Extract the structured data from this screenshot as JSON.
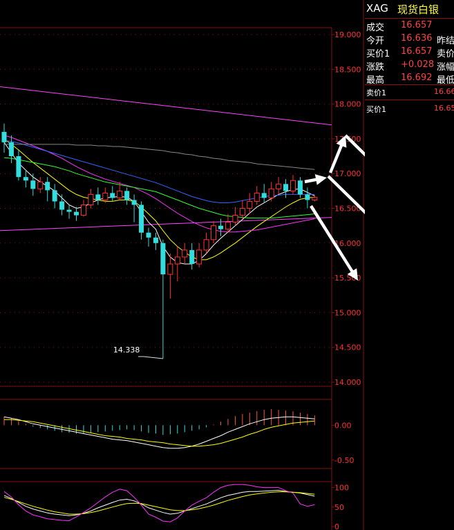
{
  "quote": {
    "code": "XAG",
    "name": "现货白银",
    "rows": [
      {
        "label": "成交",
        "value": "16.657",
        "label2": ""
      },
      {
        "label": "今开",
        "value": "16.636",
        "label2": "昨结"
      },
      {
        "label": "买价1",
        "value": "16.657",
        "label2": "卖价"
      },
      {
        "label": "涨跌",
        "value": "+0.028",
        "label2": "涨幅"
      },
      {
        "label": "最高",
        "value": "16.692",
        "label2": "最低"
      }
    ],
    "ask_label": "卖价1",
    "ask_value": "16.66",
    "bid_label": "买价1",
    "bid_value": "16.65"
  },
  "chart_data": [
    {
      "type": "candlestick",
      "panel": "price",
      "y_ticks": [
        "19.000",
        "18.500",
        "18.000",
        "17.500",
        "17.000",
        "16.500",
        "16.000",
        "15.500",
        "15.000",
        "14.500",
        "14.000"
      ],
      "ylim": [
        14.0,
        19.0
      ],
      "low_annotation": "14.338",
      "low_value": 14.338,
      "candles": [
        [
          17.6,
          17.45,
          17.72,
          17.3
        ],
        [
          17.45,
          17.25,
          17.55,
          17.15
        ],
        [
          17.25,
          16.95,
          17.35,
          16.9
        ],
        [
          16.95,
          16.9,
          17.05,
          16.8
        ],
        [
          16.9,
          16.78,
          17.0,
          16.68
        ],
        [
          16.78,
          16.88,
          16.95,
          16.72
        ],
        [
          16.88,
          16.76,
          16.95,
          16.6
        ],
        [
          16.76,
          16.6,
          16.85,
          16.5
        ],
        [
          16.6,
          16.48,
          16.7,
          16.4
        ],
        [
          16.48,
          16.45,
          16.55,
          16.35
        ],
        [
          16.45,
          16.4,
          16.52,
          16.32
        ],
        [
          16.4,
          16.55,
          16.62,
          16.38
        ],
        [
          16.55,
          16.7,
          16.78,
          16.5
        ],
        [
          16.7,
          16.62,
          16.8,
          16.55
        ],
        [
          16.62,
          16.72,
          16.8,
          16.58
        ],
        [
          16.72,
          16.65,
          16.82,
          16.6
        ],
        [
          16.65,
          16.75,
          16.88,
          16.62
        ],
        [
          16.75,
          16.62,
          16.8,
          16.55
        ],
        [
          16.62,
          16.55,
          16.7,
          16.3
        ],
        [
          16.55,
          16.15,
          16.6,
          16.05
        ],
        [
          16.15,
          16.08,
          16.22,
          15.95
        ],
        [
          16.08,
          16.0,
          16.15,
          15.9
        ],
        [
          16.0,
          15.55,
          16.05,
          14.338
        ],
        [
          15.55,
          15.7,
          15.85,
          15.2
        ],
        [
          15.7,
          15.8,
          15.95,
          15.45
        ],
        [
          15.8,
          15.9,
          16.0,
          15.7
        ],
        [
          15.9,
          15.7,
          16.0,
          15.62
        ],
        [
          15.7,
          15.9,
          16.0,
          15.65
        ],
        [
          15.9,
          16.05,
          16.15,
          15.85
        ],
        [
          16.05,
          16.25,
          16.32,
          16.0
        ],
        [
          16.25,
          16.2,
          16.35,
          16.1
        ],
        [
          16.2,
          16.3,
          16.42,
          16.15
        ],
        [
          16.3,
          16.4,
          16.52,
          16.25
        ],
        [
          16.4,
          16.5,
          16.62,
          16.35
        ],
        [
          16.5,
          16.6,
          16.72,
          16.42
        ],
        [
          16.6,
          16.72,
          16.82,
          16.55
        ],
        [
          16.72,
          16.65,
          16.85,
          16.58
        ],
        [
          16.65,
          16.78,
          16.88,
          16.6
        ],
        [
          16.78,
          16.85,
          16.95,
          16.7
        ],
        [
          16.85,
          16.75,
          16.92,
          16.65
        ],
        [
          16.75,
          16.9,
          16.98,
          16.7
        ],
        [
          16.9,
          16.7,
          16.95,
          16.65
        ],
        [
          16.7,
          16.62,
          16.8,
          16.5
        ],
        [
          16.62,
          16.657,
          16.692,
          16.6
        ]
      ],
      "ma_series": [
        {
          "color": "#ffffff",
          "values": [
            17.45,
            17.3,
            17.15,
            17.05,
            16.95,
            16.88,
            16.82,
            16.75,
            16.65,
            16.55,
            16.5,
            16.52,
            16.58,
            16.62,
            16.65,
            16.66,
            16.67,
            16.66,
            16.6,
            16.45,
            16.3,
            16.2,
            15.95,
            15.8,
            15.72,
            15.7,
            15.7,
            15.75,
            15.85,
            15.97,
            16.07,
            16.16,
            16.25,
            16.34,
            16.43,
            16.52,
            16.58,
            16.64,
            16.7,
            16.74,
            16.77,
            16.78,
            16.73,
            16.68
          ]
        },
        {
          "color": "#ffff00",
          "values": [
            17.5,
            17.42,
            17.34,
            17.25,
            17.16,
            17.08,
            17.0,
            16.92,
            16.84,
            16.76,
            16.7,
            16.66,
            16.64,
            16.62,
            16.6,
            16.6,
            16.62,
            16.62,
            16.6,
            16.52,
            16.42,
            16.32,
            16.18,
            16.05,
            15.95,
            15.87,
            15.8,
            15.76,
            15.76,
            15.8,
            15.86,
            15.93,
            16.0,
            16.08,
            16.16,
            16.24,
            16.31,
            16.38,
            16.45,
            16.52,
            16.58,
            16.63,
            16.65,
            16.66
          ]
        },
        {
          "color": "#ff33ff",
          "values": [
            17.55,
            17.52,
            17.48,
            17.44,
            17.4,
            17.36,
            17.32,
            17.27,
            17.22,
            17.16,
            17.1,
            17.05,
            17.0,
            16.96,
            16.92,
            16.89,
            16.86,
            16.83,
            16.8,
            16.75,
            16.7,
            16.64,
            16.57,
            16.5,
            16.43,
            16.37,
            16.31,
            16.26,
            16.22,
            16.19,
            16.17,
            16.16,
            16.16,
            16.17,
            16.18,
            16.19,
            16.21,
            16.23,
            16.25,
            16.27,
            16.29,
            16.31,
            16.33,
            16.35
          ]
        },
        {
          "color": "#33ff33",
          "values": [
            17.23,
            17.22,
            17.2,
            17.18,
            17.16,
            17.14,
            17.12,
            17.1,
            17.07,
            17.04,
            17.0,
            16.97,
            16.94,
            16.91,
            16.88,
            16.86,
            16.84,
            16.82,
            16.8,
            16.78,
            16.76,
            16.74,
            16.7,
            16.66,
            16.62,
            16.58,
            16.54,
            16.5,
            16.47,
            16.44,
            16.41,
            16.39,
            16.38,
            16.37,
            16.36,
            16.36,
            16.36,
            16.36,
            16.37,
            16.38,
            16.39,
            16.4,
            16.41,
            16.42
          ]
        },
        {
          "color": "#3366ff",
          "values": [
            17.48,
            17.46,
            17.44,
            17.41,
            17.38,
            17.35,
            17.32,
            17.29,
            17.26,
            17.23,
            17.2,
            17.17,
            17.14,
            17.11,
            17.08,
            17.05,
            17.02,
            16.99,
            16.96,
            16.93,
            16.9,
            16.87,
            16.83,
            16.79,
            16.75,
            16.71,
            16.67,
            16.64,
            16.61,
            16.59,
            16.58,
            16.58,
            16.59,
            16.61,
            16.63,
            16.65,
            16.67,
            16.68,
            16.69,
            16.7,
            16.7,
            16.7,
            16.7,
            16.7
          ]
        },
        {
          "color": "#888888",
          "values": [
            17.42,
            17.42,
            17.42,
            17.42,
            17.42,
            17.42,
            17.42,
            17.42,
            17.42,
            17.42,
            17.41,
            17.41,
            17.41,
            17.4,
            17.4,
            17.39,
            17.39,
            17.38,
            17.37,
            17.36,
            17.35,
            17.34,
            17.33,
            17.31,
            17.3,
            17.28,
            17.27,
            17.25,
            17.24,
            17.22,
            17.21,
            17.19,
            17.18,
            17.17,
            17.16,
            17.14,
            17.13,
            17.12,
            17.11,
            17.1,
            17.09,
            17.08,
            17.07,
            17.06
          ]
        }
      ],
      "long_lines": [
        {
          "color": "#ff44ff",
          "from": 18.25,
          "to": 17.7
        },
        {
          "color": "#ff44ff",
          "from": 16.18,
          "to": 16.37
        }
      ]
    },
    {
      "type": "bar",
      "panel": "macd",
      "y_ticks": [
        "0.00",
        "-0.50"
      ],
      "ylim": [
        -0.6,
        0.3
      ],
      "histogram": [
        0.12,
        0.1,
        0.06,
        0.02,
        -0.02,
        -0.04,
        -0.06,
        -0.08,
        -0.1,
        -0.11,
        -0.12,
        -0.12,
        -0.11,
        -0.1,
        -0.09,
        -0.08,
        -0.07,
        -0.06,
        -0.07,
        -0.09,
        -0.11,
        -0.12,
        -0.14,
        -0.13,
        -0.12,
        -0.1,
        -0.08,
        -0.06,
        -0.03,
        0.01,
        0.05,
        0.09,
        0.13,
        0.16,
        0.18,
        0.2,
        0.22,
        0.23,
        0.22,
        0.21,
        0.2,
        0.18,
        0.16,
        0.14
      ],
      "dif": [
        0.12,
        0.1,
        0.08,
        0.05,
        0.02,
        0.0,
        -0.02,
        -0.04,
        -0.06,
        -0.08,
        -0.1,
        -0.12,
        -0.14,
        -0.16,
        -0.18,
        -0.2,
        -0.21,
        -0.22,
        -0.24,
        -0.26,
        -0.28,
        -0.3,
        -0.32,
        -0.33,
        -0.33,
        -0.32,
        -0.3,
        -0.27,
        -0.23,
        -0.19,
        -0.15,
        -0.1,
        -0.06,
        -0.02,
        0.02,
        0.05,
        0.08,
        0.1,
        0.11,
        0.12,
        0.12,
        0.11,
        0.1,
        0.09
      ],
      "dea": [
        0.08,
        0.08,
        0.07,
        0.06,
        0.05,
        0.03,
        0.01,
        -0.01,
        -0.03,
        -0.05,
        -0.07,
        -0.09,
        -0.11,
        -0.13,
        -0.15,
        -0.16,
        -0.17,
        -0.19,
        -0.2,
        -0.21,
        -0.23,
        -0.24,
        -0.25,
        -0.27,
        -0.28,
        -0.29,
        -0.3,
        -0.3,
        -0.29,
        -0.28,
        -0.26,
        -0.23,
        -0.2,
        -0.17,
        -0.13,
        -0.1,
        -0.06,
        -0.03,
        -0.01,
        0.01,
        0.03,
        0.04,
        0.05,
        0.06
      ]
    },
    {
      "type": "line",
      "panel": "kdj",
      "y_ticks": [
        "100",
        "50",
        "0"
      ],
      "ylim": [
        0,
        110
      ],
      "series": [
        {
          "color": "#ffffff",
          "values": [
            80,
            72,
            62,
            52,
            45,
            40,
            35,
            32,
            30,
            28,
            30,
            34,
            40,
            48,
            55,
            62,
            68,
            70,
            66,
            58,
            48,
            42,
            36,
            32,
            34,
            40,
            46,
            52,
            58,
            66,
            74,
            80,
            84,
            88,
            90,
            90,
            91,
            92,
            93,
            90,
            88,
            86,
            82,
            78
          ]
        },
        {
          "color": "#ffff00",
          "values": [
            75,
            70,
            64,
            58,
            52,
            47,
            42,
            38,
            35,
            32,
            32,
            33,
            36,
            40,
            45,
            50,
            55,
            59,
            60,
            59,
            55,
            51,
            47,
            43,
            41,
            41,
            43,
            46,
            50,
            55,
            61,
            67,
            72,
            77,
            81,
            84,
            86,
            88,
            89,
            89,
            88,
            87,
            85,
            83
          ]
        },
        {
          "color": "#ff33ff",
          "values": [
            90,
            76,
            56,
            40,
            30,
            25,
            20,
            18,
            16,
            15,
            25,
            36,
            48,
            62,
            76,
            88,
            96,
            92,
            75,
            55,
            32,
            24,
            14,
            12,
            22,
            40,
            55,
            65,
            74,
            88,
            100,
            106,
            108,
            108,
            106,
            102,
            100,
            100,
            100,
            92,
            86,
            58,
            52,
            56
          ]
        }
      ]
    }
  ]
}
